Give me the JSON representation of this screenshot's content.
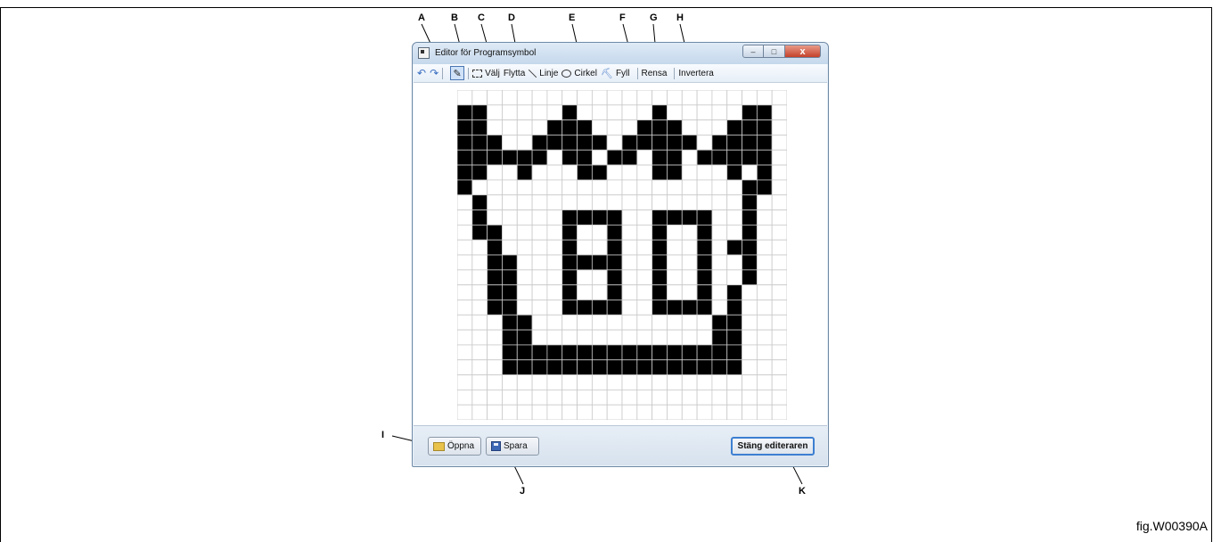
{
  "window": {
    "title": "Editor för Programsymbol",
    "controls": {
      "minimize": "–",
      "maximize": "□",
      "close": "x"
    }
  },
  "toolbar": {
    "undo_icon": "undo-icon",
    "redo_icon": "redo-icon",
    "pencil_icon": "pencil-icon",
    "select_label": "Välj",
    "move_label": "Flytta",
    "line_label": "Linje",
    "circle_label": "Cirkel",
    "fill_label": "Fyll",
    "clear_label": "Rensa",
    "invert_label": "Invertera"
  },
  "buttons": {
    "open_label": "Öppna",
    "save_label": "Spara",
    "close_editor_label": "Stäng editeraren"
  },
  "grid": {
    "cols": 22,
    "rows": 22,
    "filled_color": "#000000",
    "grid_line_color": "#c8c8c8",
    "pixels": [
      "0000000000000000000000",
      "1100000100000100000110",
      "1100001110001110001110",
      "1110011111011111011110",
      "1111110110110110111110",
      "1100100011000110001010",
      "1000000000000000000110",
      "0100000000000000000100",
      "0100000111100111100100",
      "0110000100100100100100",
      "0010000100100100101100",
      "0011000111100100100100",
      "0011000100100100100100",
      "0011000100100100101000",
      "0011000111100111101000",
      "0001100000000000011000",
      "0001100000000000011000",
      "0001111111111111111000",
      "0001111111111111111000",
      "0000000000000000000000",
      "0000000000000000000000",
      "0000000000000000000000"
    ]
  },
  "callouts": [
    "A",
    "B",
    "C",
    "D",
    "E",
    "F",
    "G",
    "H",
    "I",
    "J",
    "K"
  ],
  "figure_ref": "fig.W00390A"
}
